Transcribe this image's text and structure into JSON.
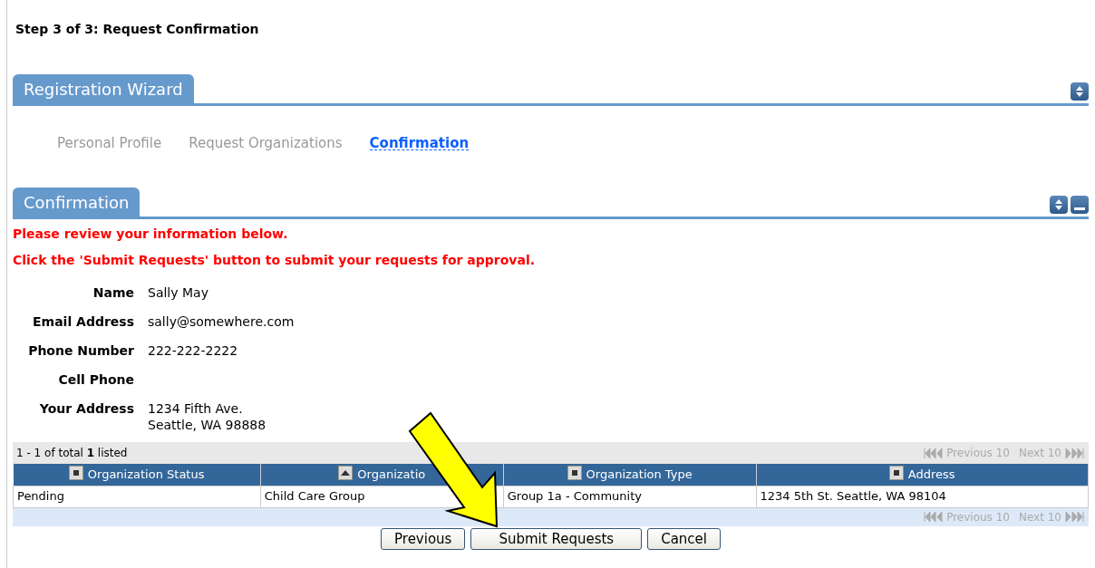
{
  "page_title": "Step 3 of 3: Request Confirmation",
  "wizard": {
    "title": "Registration Wizard",
    "steps": [
      {
        "label": "Personal Profile",
        "selected": false
      },
      {
        "label": "Request Organizations",
        "selected": false
      },
      {
        "label": "Confirmation",
        "selected": true
      }
    ]
  },
  "confirmation": {
    "title": "Confirmation",
    "messages": [
      "Please review your information below.",
      "Click the 'Submit Requests' button to submit your requests for approval."
    ],
    "fields": [
      {
        "label": "Name",
        "value": [
          "Sally May"
        ]
      },
      {
        "label": "Email Address",
        "value": [
          "sally@somewhere.com"
        ]
      },
      {
        "label": "Phone Number",
        "value": [
          "222-222-2222"
        ]
      },
      {
        "label": "Cell Phone"
      },
      {
        "label": "Your Address",
        "value": [
          "1234 Fifth Ave.",
          "Seattle, WA 98888"
        ]
      }
    ]
  },
  "table": {
    "summary": "1 - 1 of total **1** listed",
    "pager_top": {
      "previous": "Previous 10",
      "next": "Next 10",
      "disabled": true
    },
    "columns": [
      {
        "label": "Organization Status",
        "sorted": false
      },
      {
        "label": "Organizatio",
        "sorted": true
      },
      {
        "label": "Organization Type",
        "sorted": false
      },
      {
        "label": "Address",
        "sorted": false
      }
    ],
    "rows": [
      [
        "Pending",
        "Child Care Group",
        "Group 1a - Community",
        "1234 5th St. Seattle, WA 98104"
      ]
    ],
    "pager_bottom": {
      "previous": "Previous 10",
      "next": "Next 10",
      "disabled": true
    }
  },
  "buttons": [
    "Previous",
    "Submit Requests",
    "Cancel"
  ],
  "annotation": {
    "kind": "arrow"
  }
}
